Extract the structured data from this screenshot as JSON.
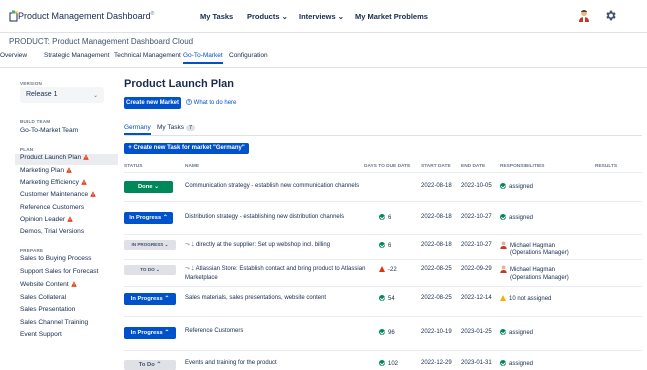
{
  "header": {
    "app_title": "Product Management Dashboard",
    "app_title_mark": "®",
    "nav": [
      "My Tasks",
      "Products",
      "Interviews",
      "My Market Problems"
    ]
  },
  "breadcrumb": "PRODUCT: Product Management Dashboard Cloud",
  "tabs": [
    "Overview",
    "Strategic Management",
    "Technical Management",
    "Go-To-Market",
    "Configuration"
  ],
  "sidebar": {
    "version_label": "VERSION",
    "version_value": "Release 1",
    "build_team_label": "BUILD TEAM",
    "build_team_value": "Go-To-Market Team",
    "plan_label": "PLAN",
    "plan_items": [
      "Product Launch Plan",
      "Marketing Plan",
      "Marketing Efficiency",
      "Customer Maintenance",
      "Reference Customers",
      "Opinion Leader",
      "Demos, Trial Versions"
    ],
    "prepare_label": "PREPARE",
    "prepare_items": [
      "Sales to Buying Process",
      "Support Sales for Forecast",
      "Website Content",
      "Sales Collateral",
      "Sales Presentation",
      "Sales Channel Training",
      "Event Support"
    ]
  },
  "main": {
    "title": "Product Launch Plan",
    "create_market_button": "Create new Market",
    "what_to_do_link": "What to do here",
    "subtabs": [
      "Germany",
      "My Tasks"
    ],
    "my_tasks_count": "7",
    "create_task_button": "Create new Task for market \"Germany\"",
    "columns": [
      "STATUS",
      "NAME",
      "DAYS TO DUE DATE",
      "START DATE",
      "END DATE",
      "RESPONSIBILITIES",
      "RESULTS"
    ],
    "rows": [
      {
        "status": "Done",
        "name": "Communication strategy - establish new communication channels",
        "days": "",
        "start": "2022-08-18",
        "end": "2022-10-05",
        "resp": "assigned"
      },
      {
        "status": "In Progress",
        "name": "Distribution strategy - establishing new distribution channels",
        "days": "6",
        "start": "2022-08-18",
        "end": "2022-10-27",
        "resp": "assigned"
      },
      {
        "status": "IN PROGRESS",
        "name": "directly at the supplier: Set up webshop incl. billing",
        "days": "6",
        "start": "2022-08-18",
        "end": "2022-10-27",
        "resp": "Michael Hagman",
        "resp2": "(Operations Manager)"
      },
      {
        "status": "TO DO",
        "name": "Atlassian Store: Establish contact and bring product to Atlassian",
        "name2": "Marketplace",
        "days": "-22",
        "start": "2022-08-25",
        "end": "2022-09-29",
        "resp": "Michael Hagman",
        "resp2": "(Operations Manager)"
      },
      {
        "status": "In Progress",
        "name": "Sales materials, sales presentations, website content",
        "days": "54",
        "start": "2022-08-25",
        "end": "2022-12-14",
        "resp": "10 not assigned"
      },
      {
        "status": "In Progress",
        "name": "Reference Customers",
        "days": "96",
        "start": "2022-10-19",
        "end": "2023-01-25",
        "resp": "assigned"
      },
      {
        "status": "To Do",
        "name": "Events and training for the product",
        "days": "102",
        "start": "2022-12-29",
        "end": "2023-01-31",
        "resp": "assigned"
      }
    ]
  }
}
